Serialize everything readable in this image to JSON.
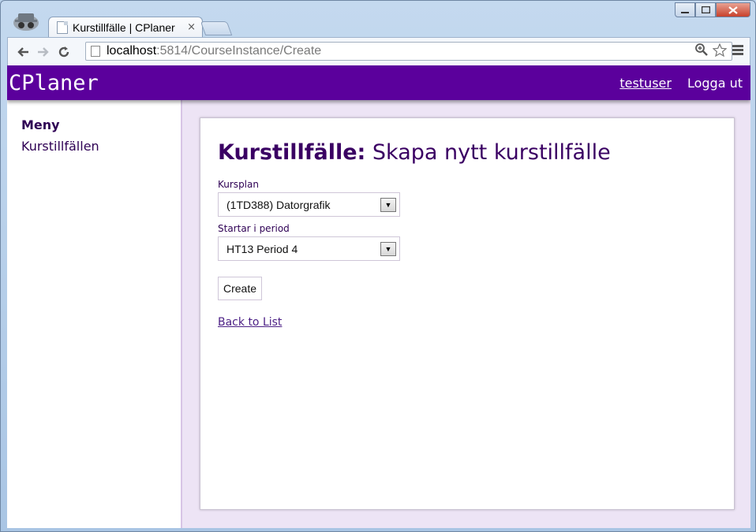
{
  "browser": {
    "tab_title": "Kurstillfälle | CPlaner",
    "tab_close": "×",
    "url_host": "localhost",
    "url_rest": ":5814/CourseInstance/Create",
    "zoom_icon": "zoom-icon",
    "star_icon": "star-icon"
  },
  "header": {
    "brand": "CPlaner",
    "user": "testuser",
    "logout": "Logga ut"
  },
  "sidebar": {
    "heading": "Meny",
    "items": [
      {
        "label": "Kurstillfällen"
      }
    ]
  },
  "main": {
    "title_bold": "Kurstillfälle:",
    "title_rest": " Skapa nytt kurstillfälle",
    "fields": [
      {
        "label": "Kursplan",
        "value": "(1TD388) Datorgrafik"
      },
      {
        "label": "Startar i period",
        "value": "HT13 Period 4"
      }
    ],
    "create_button": "Create",
    "back_link": "Back to List"
  }
}
